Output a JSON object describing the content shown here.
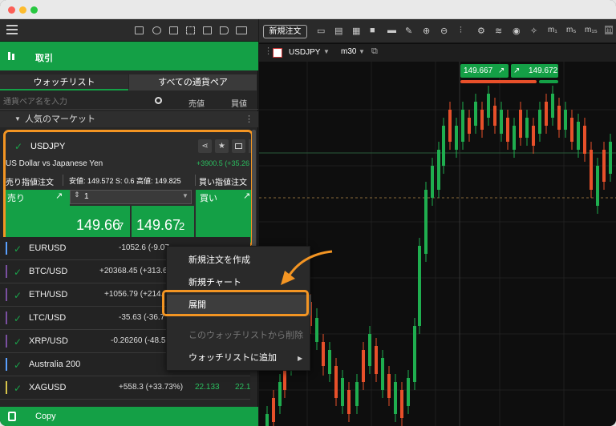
{
  "toolbar": {
    "new_order": "新規注文"
  },
  "left": {
    "section_title": "取引",
    "tabs": [
      "ウォッチリスト",
      "すべての通貨ペア"
    ],
    "search_placeholder": "通貨ペア名を入力",
    "col_sell": "売値",
    "col_buy": "買値",
    "group": "人気のマーケット",
    "card": {
      "symbol": "USDJPY",
      "description": "US Dollar vs Japanese Yen",
      "change": "+3900.5 (+35.26",
      "sell_order": "売り指値注文",
      "stats": "安値: 149.572  S: 0.6  高値: 149.825",
      "buy_order": "買い指値注文",
      "sell_label": "売り",
      "buy_label": "買い",
      "qty": "1",
      "bid_main": "149.66",
      "bid_pip": "7",
      "ask_main": "149.67",
      "ask_pip": "2"
    },
    "rows": [
      {
        "name": "EURUSD",
        "change": "-1052.6 (-9.07",
        "bid": "",
        "ask": "",
        "color": "#5aa0ff"
      },
      {
        "name": "BTC/USD",
        "change": "+20368.45 (+313.65",
        "bid": "",
        "ask": "",
        "color": "#7a4fa0"
      },
      {
        "name": "ETH/USD",
        "change": "+1056.79 (+214.",
        "bid": "",
        "ask": "",
        "color": "#7a4fa0"
      },
      {
        "name": "LTC/USD",
        "change": "-35.63 (-36.7",
        "bid": "",
        "ask": "",
        "color": "#7a4fa0"
      },
      {
        "name": "XRP/USD",
        "change": "-0.26260 (-48.51",
        "bid": "",
        "ask": "",
        "color": "#7a4fa0"
      },
      {
        "name": "Australia 200",
        "change": "",
        "bid": "",
        "ask": "",
        "color": "#5aa0ff"
      },
      {
        "name": "XAGUSD",
        "change": "+558.3 (+33.73%)",
        "bid": "22.133",
        "ask": "22.1",
        "color": "#d7c44a"
      }
    ],
    "bottom": "Copy"
  },
  "chart": {
    "symbol": "USDJPY",
    "tf": "m30",
    "sell_price": "149.667",
    "buy_price": "149.672"
  },
  "context_menu": {
    "items": [
      "新規注文を作成",
      "新規チャート",
      "展開",
      "このウォッチリストから削除",
      "ウォッチリストに追加"
    ]
  },
  "colors": {
    "green": "#14a046",
    "orange": "#f39523",
    "sell": "#e8502a"
  }
}
